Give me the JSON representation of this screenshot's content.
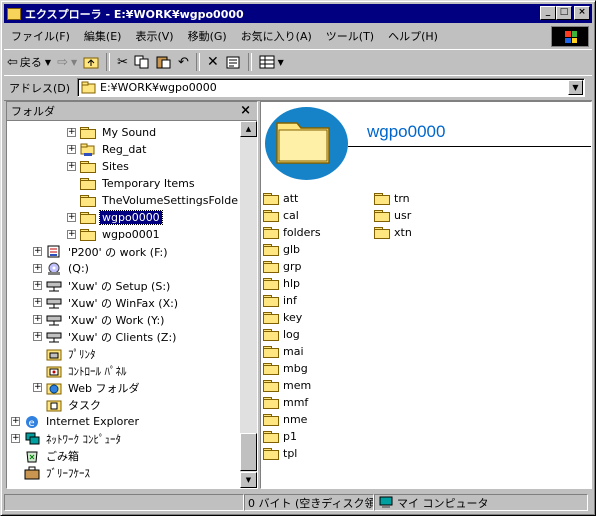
{
  "window": {
    "title": "エクスプローラ - E:¥WORK¥wgpo0000"
  },
  "menu": [
    "ファイル(F)",
    "編集(E)",
    "表示(V)",
    "移動(G)",
    "お気に入り(A)",
    "ツール(T)",
    "ヘルプ(H)"
  ],
  "toolbar": {
    "back_label": "戻る"
  },
  "address": {
    "label": "アドレス(D)",
    "value": "E:¥WORK¥wgpo0000"
  },
  "folders_pane": {
    "title": "フォルダ",
    "close": "×"
  },
  "tree": [
    {
      "label": "My Sound",
      "expander": "+"
    },
    {
      "label": "Reg_dat",
      "expander": "+"
    },
    {
      "label": "Sites",
      "expander": "+"
    },
    {
      "label": "Temporary Items",
      "expander": ""
    },
    {
      "label": "TheVolumeSettingsFolder",
      "expander": ""
    },
    {
      "label": "wgpo0000",
      "expander": "+",
      "selected": true
    },
    {
      "label": "wgpo0001",
      "expander": "+"
    },
    {
      "label": "'P200' の work (F:)",
      "expander": "+"
    },
    {
      "label": "(Q:)",
      "expander": "+"
    },
    {
      "label": "'Xuw' の Setup (S:)",
      "expander": "+"
    },
    {
      "label": "'Xuw' の WinFax (X:)",
      "expander": "+"
    },
    {
      "label": "'Xuw' の Work (Y:)",
      "expander": "+"
    },
    {
      "label": "'Xuw' の Clients (Z:)",
      "expander": "+"
    },
    {
      "label": "ﾌﾟﾘﾝﾀ",
      "expander": ""
    },
    {
      "label": "ｺﾝﾄﾛｰﾙ ﾊﾟﾈﾙ",
      "expander": ""
    },
    {
      "label": "Web フォルダ",
      "expander": "+"
    },
    {
      "label": "タスク",
      "expander": ""
    },
    {
      "label": "Internet Explorer",
      "expander": "+"
    },
    {
      "label": "ﾈｯﾄﾜｰｸ ｺﾝﾋﾟｭｰﾀ",
      "expander": "+"
    },
    {
      "label": "ごみ箱",
      "expander": ""
    },
    {
      "label": "ﾌﾞﾘｰﾌｹｰｽ",
      "expander": ""
    }
  ],
  "content": {
    "heading": "wgpo0000",
    "column1": [
      "att",
      "cal",
      "folders",
      "glb",
      "grp",
      "hlp",
      "inf",
      "key",
      "log",
      "mai",
      "mbg",
      "mem",
      "mmf",
      "nme",
      "p1",
      "tpl"
    ],
    "column2": [
      "trn",
      "usr",
      "xtn"
    ]
  },
  "status": {
    "size": "0 バイト (空きディスク領",
    "location": "マイ コンピュータ"
  },
  "colors": {
    "title_bg": "#000080",
    "accent_circle": "#1683c9",
    "heading": "#0066cc"
  }
}
